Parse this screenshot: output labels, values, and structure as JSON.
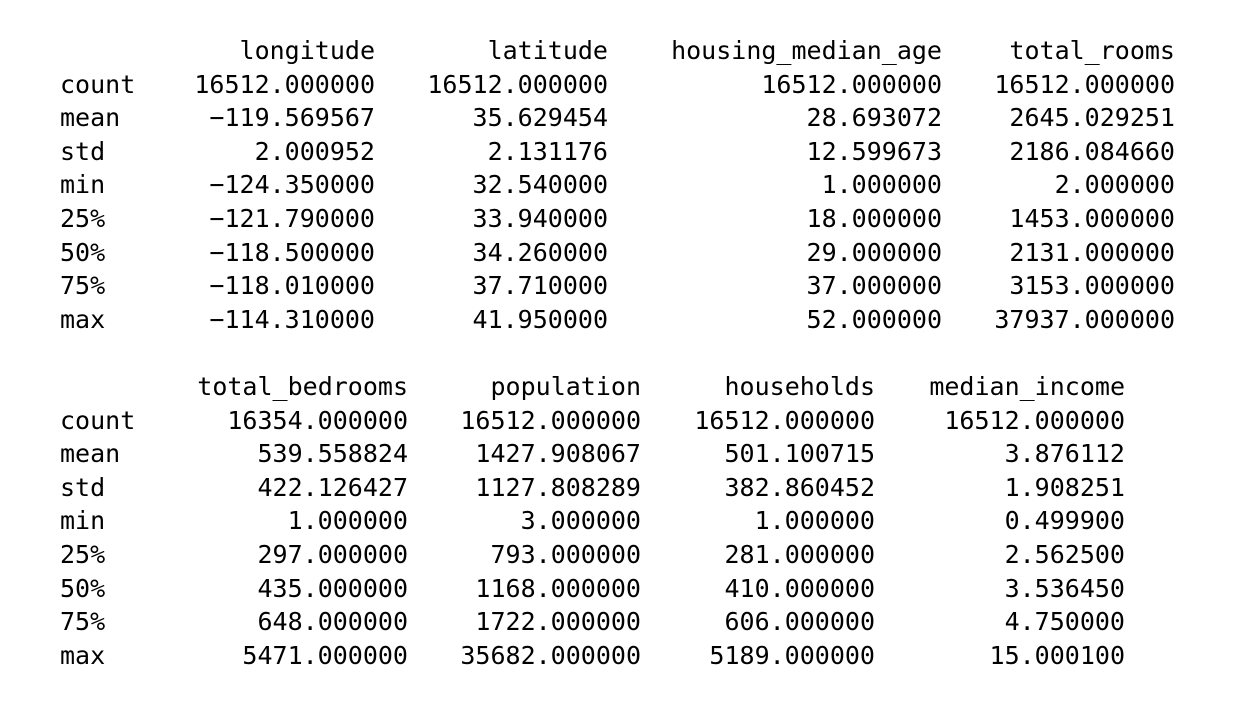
{
  "tables": [
    {
      "columns": [
        "longitude",
        "latitude",
        "housing_median_age",
        "total_rooms"
      ],
      "rows": [
        {
          "label": "count",
          "values": [
            "16512.000000",
            "16512.000000",
            "16512.000000",
            "16512.000000"
          ]
        },
        {
          "label": "mean",
          "values": [
            "-119.569567",
            "35.629454",
            "28.693072",
            "2645.029251"
          ]
        },
        {
          "label": "std",
          "values": [
            "2.000952",
            "2.131176",
            "12.599673",
            "2186.084660"
          ]
        },
        {
          "label": "min",
          "values": [
            "-124.350000",
            "32.540000",
            "1.000000",
            "2.000000"
          ]
        },
        {
          "label": "25%",
          "values": [
            "-121.790000",
            "33.940000",
            "18.000000",
            "1453.000000"
          ]
        },
        {
          "label": "50%",
          "values": [
            "-118.500000",
            "34.260000",
            "29.000000",
            "2131.000000"
          ]
        },
        {
          "label": "75%",
          "values": [
            "-118.010000",
            "37.710000",
            "37.000000",
            "3153.000000"
          ]
        },
        {
          "label": "max",
          "values": [
            "-114.310000",
            "41.950000",
            "52.000000",
            "37937.000000"
          ]
        }
      ]
    },
    {
      "columns": [
        "total_bedrooms",
        "population",
        "households",
        "median_income"
      ],
      "rows": [
        {
          "label": "count",
          "values": [
            "16354.000000",
            "16512.000000",
            "16512.000000",
            "16512.000000"
          ]
        },
        {
          "label": "mean",
          "values": [
            "539.558824",
            "1427.908067",
            "501.100715",
            "3.876112"
          ]
        },
        {
          "label": "std",
          "values": [
            "422.126427",
            "1127.808289",
            "382.860452",
            "1.908251"
          ]
        },
        {
          "label": "min",
          "values": [
            "1.000000",
            "3.000000",
            "1.000000",
            "0.499900"
          ]
        },
        {
          "label": "25%",
          "values": [
            "297.000000",
            "793.000000",
            "281.000000",
            "2.562500"
          ]
        },
        {
          "label": "50%",
          "values": [
            "435.000000",
            "1168.000000",
            "410.000000",
            "3.536450"
          ]
        },
        {
          "label": "75%",
          "values": [
            "648.000000",
            "1722.000000",
            "606.000000",
            "4.750000"
          ]
        },
        {
          "label": "max",
          "values": [
            "5471.000000",
            "35682.000000",
            "5189.000000",
            "15.000100"
          ]
        }
      ]
    }
  ]
}
